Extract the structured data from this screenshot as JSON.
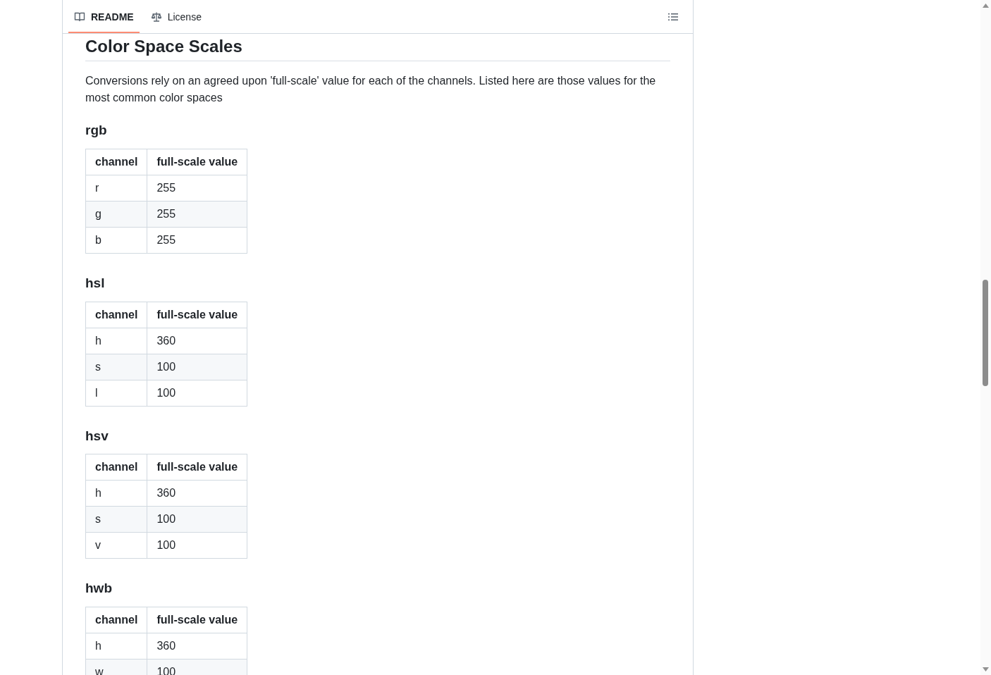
{
  "tabs": [
    {
      "label": "README",
      "kind": "book",
      "selected": true
    },
    {
      "label": "License",
      "kind": "scale",
      "selected": false
    }
  ],
  "title": "Color Space Scales",
  "intro": "Conversions rely on an agreed upon 'full-scale' value for each of the channels. Listed here are those values for the most common color spaces",
  "sections": [
    {
      "heading": "rgb",
      "columns": [
        "channel",
        "full-scale value"
      ],
      "rows": [
        [
          "r",
          "255"
        ],
        [
          "g",
          "255"
        ],
        [
          "b",
          "255"
        ]
      ]
    },
    {
      "heading": "hsl",
      "columns": [
        "channel",
        "full-scale value"
      ],
      "rows": [
        [
          "h",
          "360"
        ],
        [
          "s",
          "100"
        ],
        [
          "l",
          "100"
        ]
      ]
    },
    {
      "heading": "hsv",
      "columns": [
        "channel",
        "full-scale value"
      ],
      "rows": [
        [
          "h",
          "360"
        ],
        [
          "s",
          "100"
        ],
        [
          "v",
          "100"
        ]
      ]
    },
    {
      "heading": "hwb",
      "columns": [
        "channel",
        "full-scale value"
      ],
      "rows": [
        [
          "h",
          "360"
        ],
        [
          "w",
          "100"
        ]
      ]
    }
  ]
}
